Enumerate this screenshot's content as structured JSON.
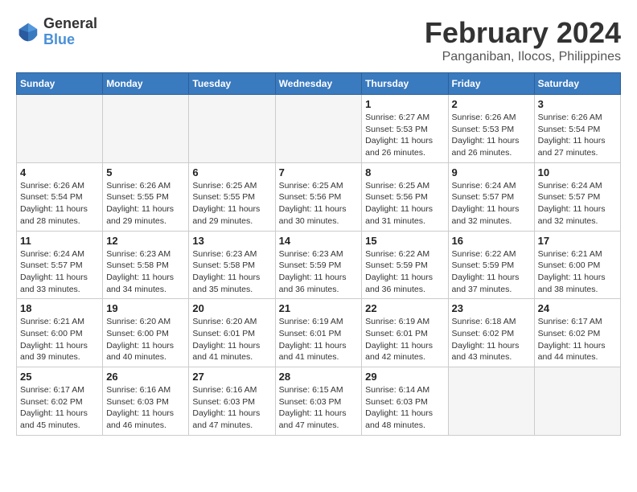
{
  "header": {
    "logo_line1": "General",
    "logo_line2": "Blue",
    "month_year": "February 2024",
    "location": "Panganiban, Ilocos, Philippines"
  },
  "days_of_week": [
    "Sunday",
    "Monday",
    "Tuesday",
    "Wednesday",
    "Thursday",
    "Friday",
    "Saturday"
  ],
  "weeks": [
    [
      {
        "day": "",
        "empty": true
      },
      {
        "day": "",
        "empty": true
      },
      {
        "day": "",
        "empty": true
      },
      {
        "day": "",
        "empty": true
      },
      {
        "day": "1",
        "sunrise": "6:27 AM",
        "sunset": "5:53 PM",
        "daylight": "11 hours and 26 minutes."
      },
      {
        "day": "2",
        "sunrise": "6:26 AM",
        "sunset": "5:53 PM",
        "daylight": "11 hours and 26 minutes."
      },
      {
        "day": "3",
        "sunrise": "6:26 AM",
        "sunset": "5:54 PM",
        "daylight": "11 hours and 27 minutes."
      }
    ],
    [
      {
        "day": "4",
        "sunrise": "6:26 AM",
        "sunset": "5:54 PM",
        "daylight": "11 hours and 28 minutes."
      },
      {
        "day": "5",
        "sunrise": "6:26 AM",
        "sunset": "5:55 PM",
        "daylight": "11 hours and 29 minutes."
      },
      {
        "day": "6",
        "sunrise": "6:25 AM",
        "sunset": "5:55 PM",
        "daylight": "11 hours and 29 minutes."
      },
      {
        "day": "7",
        "sunrise": "6:25 AM",
        "sunset": "5:56 PM",
        "daylight": "11 hours and 30 minutes."
      },
      {
        "day": "8",
        "sunrise": "6:25 AM",
        "sunset": "5:56 PM",
        "daylight": "11 hours and 31 minutes."
      },
      {
        "day": "9",
        "sunrise": "6:24 AM",
        "sunset": "5:57 PM",
        "daylight": "11 hours and 32 minutes."
      },
      {
        "day": "10",
        "sunrise": "6:24 AM",
        "sunset": "5:57 PM",
        "daylight": "11 hours and 32 minutes."
      }
    ],
    [
      {
        "day": "11",
        "sunrise": "6:24 AM",
        "sunset": "5:57 PM",
        "daylight": "11 hours and 33 minutes."
      },
      {
        "day": "12",
        "sunrise": "6:23 AM",
        "sunset": "5:58 PM",
        "daylight": "11 hours and 34 minutes."
      },
      {
        "day": "13",
        "sunrise": "6:23 AM",
        "sunset": "5:58 PM",
        "daylight": "11 hours and 35 minutes."
      },
      {
        "day": "14",
        "sunrise": "6:23 AM",
        "sunset": "5:59 PM",
        "daylight": "11 hours and 36 minutes."
      },
      {
        "day": "15",
        "sunrise": "6:22 AM",
        "sunset": "5:59 PM",
        "daylight": "11 hours and 36 minutes."
      },
      {
        "day": "16",
        "sunrise": "6:22 AM",
        "sunset": "5:59 PM",
        "daylight": "11 hours and 37 minutes."
      },
      {
        "day": "17",
        "sunrise": "6:21 AM",
        "sunset": "6:00 PM",
        "daylight": "11 hours and 38 minutes."
      }
    ],
    [
      {
        "day": "18",
        "sunrise": "6:21 AM",
        "sunset": "6:00 PM",
        "daylight": "11 hours and 39 minutes."
      },
      {
        "day": "19",
        "sunrise": "6:20 AM",
        "sunset": "6:00 PM",
        "daylight": "11 hours and 40 minutes."
      },
      {
        "day": "20",
        "sunrise": "6:20 AM",
        "sunset": "6:01 PM",
        "daylight": "11 hours and 41 minutes."
      },
      {
        "day": "21",
        "sunrise": "6:19 AM",
        "sunset": "6:01 PM",
        "daylight": "11 hours and 41 minutes."
      },
      {
        "day": "22",
        "sunrise": "6:19 AM",
        "sunset": "6:01 PM",
        "daylight": "11 hours and 42 minutes."
      },
      {
        "day": "23",
        "sunrise": "6:18 AM",
        "sunset": "6:02 PM",
        "daylight": "11 hours and 43 minutes."
      },
      {
        "day": "24",
        "sunrise": "6:17 AM",
        "sunset": "6:02 PM",
        "daylight": "11 hours and 44 minutes."
      }
    ],
    [
      {
        "day": "25",
        "sunrise": "6:17 AM",
        "sunset": "6:02 PM",
        "daylight": "11 hours and 45 minutes."
      },
      {
        "day": "26",
        "sunrise": "6:16 AM",
        "sunset": "6:03 PM",
        "daylight": "11 hours and 46 minutes."
      },
      {
        "day": "27",
        "sunrise": "6:16 AM",
        "sunset": "6:03 PM",
        "daylight": "11 hours and 47 minutes."
      },
      {
        "day": "28",
        "sunrise": "6:15 AM",
        "sunset": "6:03 PM",
        "daylight": "11 hours and 47 minutes."
      },
      {
        "day": "29",
        "sunrise": "6:14 AM",
        "sunset": "6:03 PM",
        "daylight": "11 hours and 48 minutes."
      },
      {
        "day": "",
        "empty": true
      },
      {
        "day": "",
        "empty": true
      }
    ]
  ]
}
